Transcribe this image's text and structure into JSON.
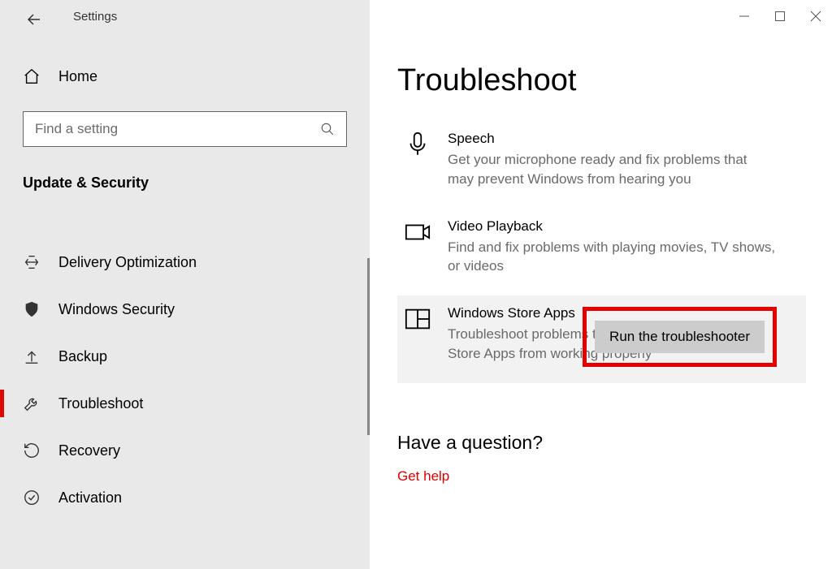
{
  "header": {
    "app_title": "Settings"
  },
  "sidebar": {
    "home_label": "Home",
    "search_placeholder": "Find a setting",
    "category_title": "Update & Security",
    "nav": [
      {
        "label": "Delivery Optimization",
        "icon": "delivery-optimization-icon",
        "selected": false
      },
      {
        "label": "Windows Security",
        "icon": "shield-icon",
        "selected": false
      },
      {
        "label": "Backup",
        "icon": "backup-icon",
        "selected": false
      },
      {
        "label": "Troubleshoot",
        "icon": "wrench-icon",
        "selected": true
      },
      {
        "label": "Recovery",
        "icon": "recovery-icon",
        "selected": false
      },
      {
        "label": "Activation",
        "icon": "activation-icon",
        "selected": false
      }
    ]
  },
  "main": {
    "title": "Troubleshoot",
    "items": [
      {
        "title": "Speech",
        "desc": "Get your microphone ready and fix problems that may prevent Windows from hearing you",
        "icon": "microphone-icon",
        "selected": false
      },
      {
        "title": "Video Playback",
        "desc": "Find and fix problems with playing movies, TV shows, or videos",
        "icon": "video-icon",
        "selected": false
      },
      {
        "title": "Windows Store Apps",
        "desc": "Troubleshoot problems that may prevent Windows Store Apps from working properly",
        "icon": "store-apps-icon",
        "selected": true
      }
    ],
    "run_button": "Run the troubleshooter",
    "question_title": "Have a question?",
    "help_link": "Get help"
  }
}
